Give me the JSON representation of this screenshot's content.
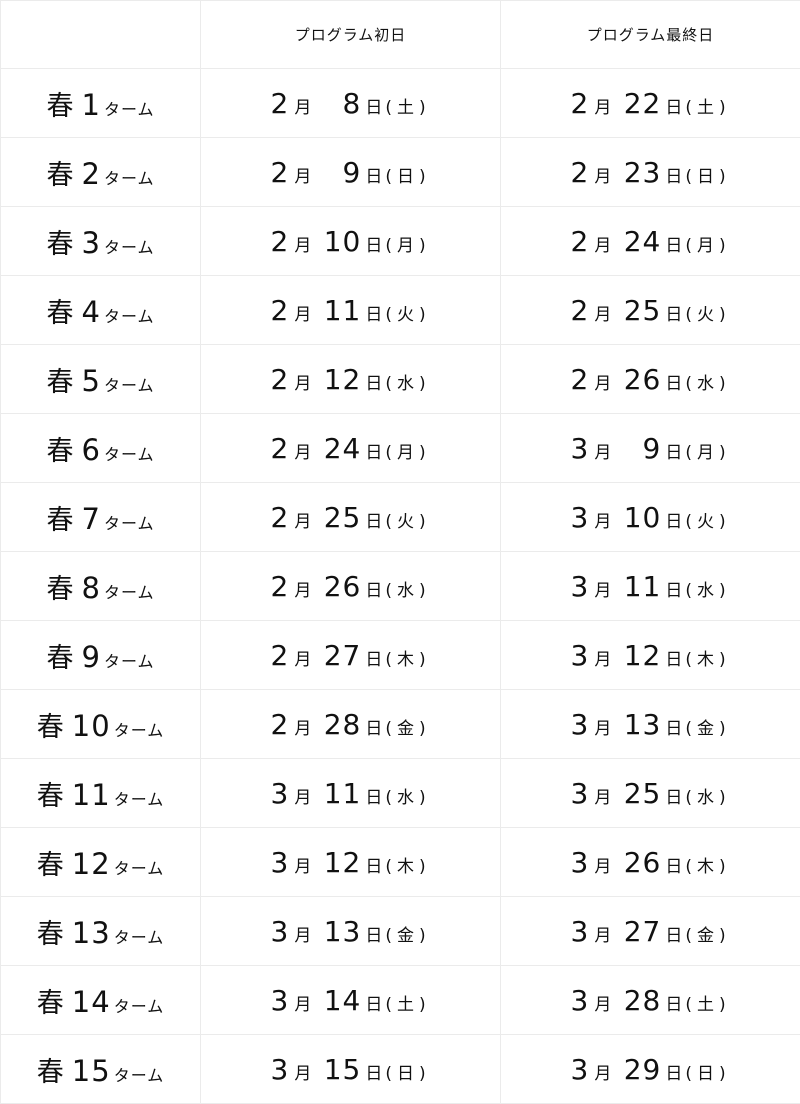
{
  "header": {
    "corner": "",
    "first_day": "プログラム初日",
    "last_day": "プログラム最終日"
  },
  "units": {
    "season": "春",
    "term_suffix": "ターム",
    "month": "月",
    "day": "日",
    "open_paren": "(",
    "close_paren": ")"
  },
  "rows": [
    {
      "term": "1",
      "start": {
        "month": "2",
        "day": "8",
        "weekday": "土"
      },
      "end": {
        "month": "2",
        "day": "22",
        "weekday": "土"
      }
    },
    {
      "term": "2",
      "start": {
        "month": "2",
        "day": "9",
        "weekday": "日"
      },
      "end": {
        "month": "2",
        "day": "23",
        "weekday": "日"
      }
    },
    {
      "term": "3",
      "start": {
        "month": "2",
        "day": "10",
        "weekday": "月"
      },
      "end": {
        "month": "2",
        "day": "24",
        "weekday": "月"
      }
    },
    {
      "term": "4",
      "start": {
        "month": "2",
        "day": "11",
        "weekday": "火"
      },
      "end": {
        "month": "2",
        "day": "25",
        "weekday": "火"
      }
    },
    {
      "term": "5",
      "start": {
        "month": "2",
        "day": "12",
        "weekday": "水"
      },
      "end": {
        "month": "2",
        "day": "26",
        "weekday": "水"
      }
    },
    {
      "term": "6",
      "start": {
        "month": "2",
        "day": "24",
        "weekday": "月"
      },
      "end": {
        "month": "3",
        "day": "9",
        "weekday": "月"
      }
    },
    {
      "term": "7",
      "start": {
        "month": "2",
        "day": "25",
        "weekday": "火"
      },
      "end": {
        "month": "3",
        "day": "10",
        "weekday": "火"
      }
    },
    {
      "term": "8",
      "start": {
        "month": "2",
        "day": "26",
        "weekday": "水"
      },
      "end": {
        "month": "3",
        "day": "11",
        "weekday": "水"
      }
    },
    {
      "term": "9",
      "start": {
        "month": "2",
        "day": "27",
        "weekday": "木"
      },
      "end": {
        "month": "3",
        "day": "12",
        "weekday": "木"
      }
    },
    {
      "term": "10",
      "start": {
        "month": "2",
        "day": "28",
        "weekday": "金"
      },
      "end": {
        "month": "3",
        "day": "13",
        "weekday": "金"
      }
    },
    {
      "term": "11",
      "start": {
        "month": "3",
        "day": "11",
        "weekday": "水"
      },
      "end": {
        "month": "3",
        "day": "25",
        "weekday": "水"
      }
    },
    {
      "term": "12",
      "start": {
        "month": "3",
        "day": "12",
        "weekday": "木"
      },
      "end": {
        "month": "3",
        "day": "26",
        "weekday": "木"
      }
    },
    {
      "term": "13",
      "start": {
        "month": "3",
        "day": "13",
        "weekday": "金"
      },
      "end": {
        "month": "3",
        "day": "27",
        "weekday": "金"
      }
    },
    {
      "term": "14",
      "start": {
        "month": "3",
        "day": "14",
        "weekday": "土"
      },
      "end": {
        "month": "3",
        "day": "28",
        "weekday": "土"
      }
    },
    {
      "term": "15",
      "start": {
        "month": "3",
        "day": "15",
        "weekday": "日"
      },
      "end": {
        "month": "3",
        "day": "29",
        "weekday": "日"
      }
    }
  ]
}
